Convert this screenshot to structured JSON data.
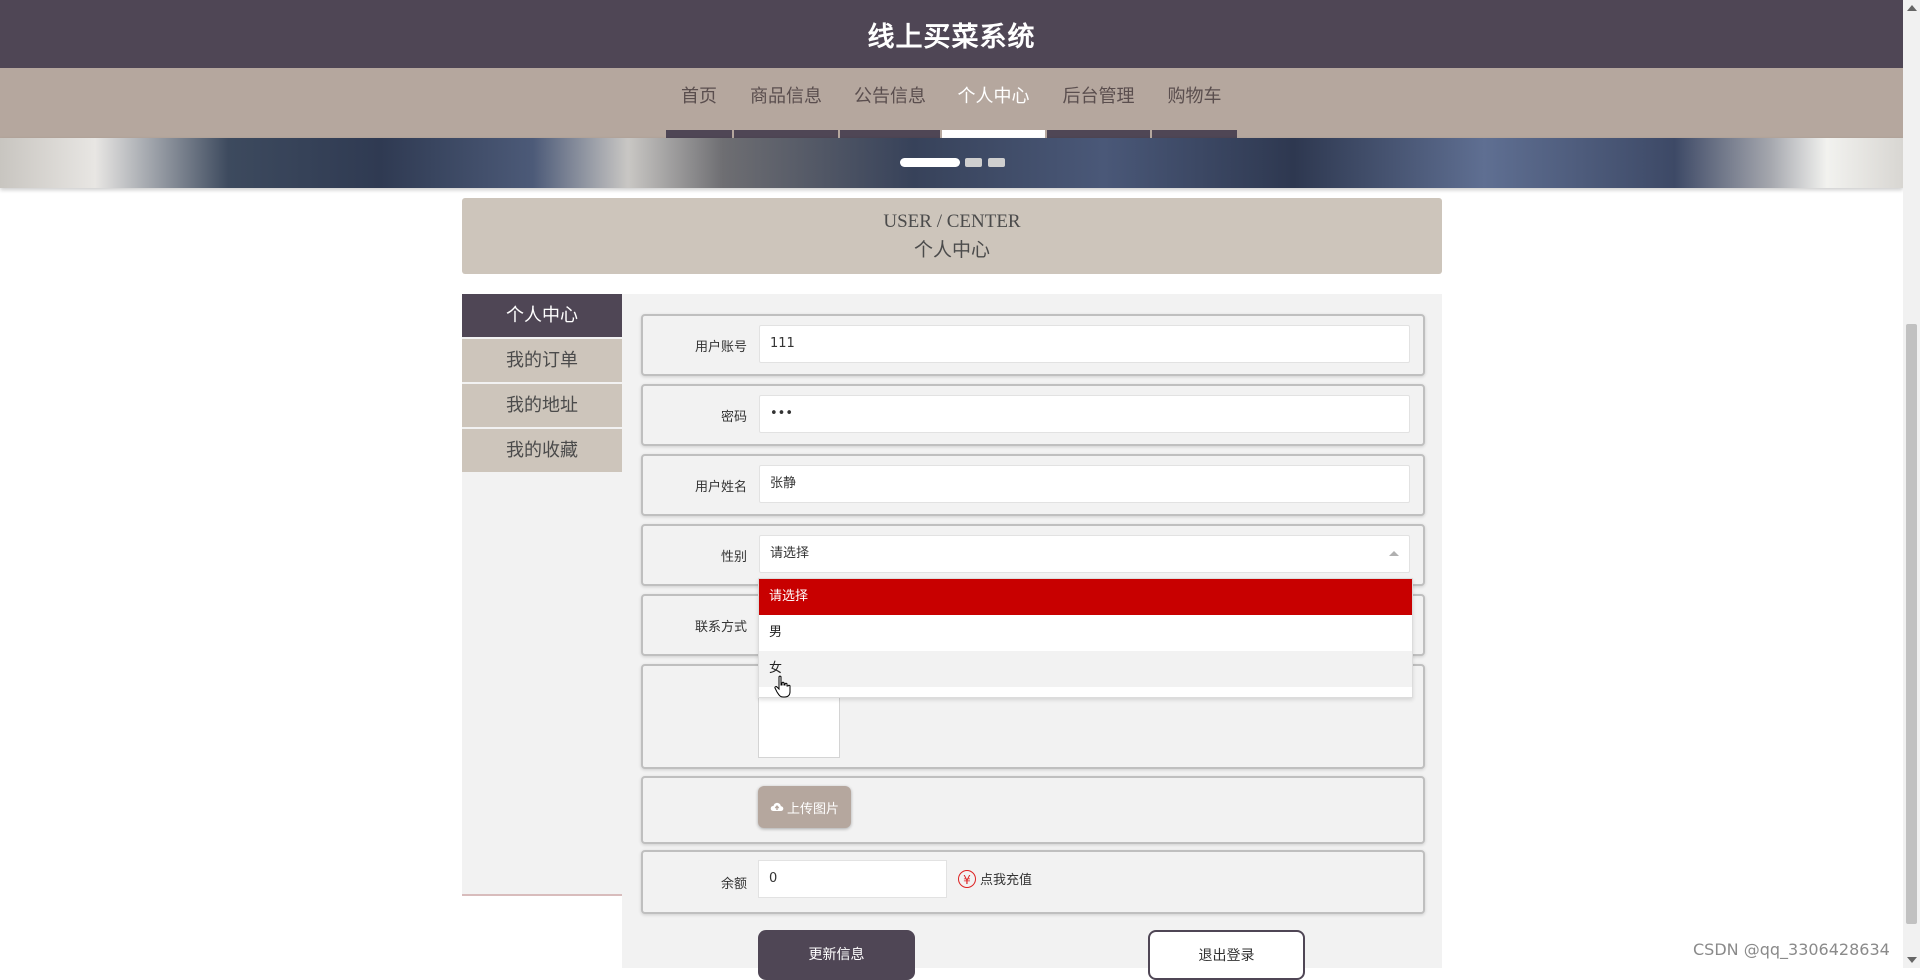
{
  "header": {
    "title": "线上买菜系统"
  },
  "nav": {
    "items": [
      {
        "label": "首页"
      },
      {
        "label": "商品信息"
      },
      {
        "label": "公告信息"
      },
      {
        "label": "个人中心",
        "active": true
      },
      {
        "label": "后台管理"
      },
      {
        "label": "购物车"
      }
    ]
  },
  "banner": {
    "slide_count": 3,
    "active_slide": 1
  },
  "center_header": {
    "en": "USER / CENTER",
    "cn": "个人中心"
  },
  "sidebar": {
    "items": [
      {
        "label": "个人中心",
        "active": true
      },
      {
        "label": "我的订单"
      },
      {
        "label": "我的地址"
      },
      {
        "label": "我的收藏"
      }
    ]
  },
  "form": {
    "account": {
      "label": "用户账号",
      "value": "111"
    },
    "password": {
      "label": "密码",
      "value": "•••"
    },
    "name": {
      "label": "用户姓名",
      "value": "张静"
    },
    "gender": {
      "label": "性别",
      "placeholder": "请选择",
      "options": [
        "请选择",
        "男",
        "女"
      ],
      "highlighted_option": "请选择",
      "hovered_option": "女"
    },
    "contact": {
      "label": "联系方式"
    },
    "upload_label": "上传图片",
    "balance": {
      "label": "余额",
      "value": "0",
      "recharge_label": "点我充值"
    },
    "update_button": "更新信息",
    "logout_button": "退出登录"
  },
  "watermark": "CSDN @qq_3306428634",
  "colors": {
    "primary": "#4f4655",
    "nav_bg": "#b5a79e",
    "panel_beige": "#cdc5bb",
    "dropdown_selected": "#c80000",
    "recharge_icon": "#d22222"
  }
}
